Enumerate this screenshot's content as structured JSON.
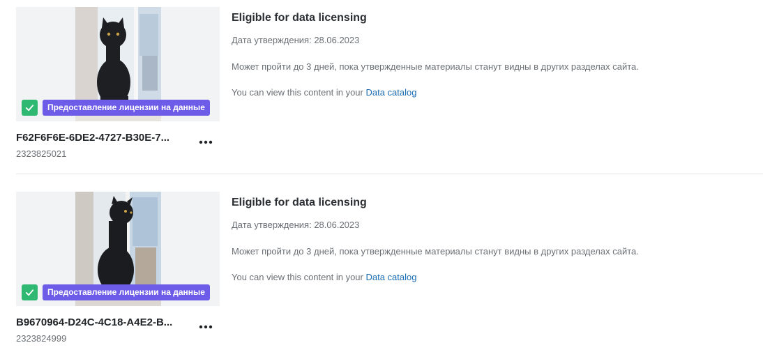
{
  "items": [
    {
      "badge_label": "Предоставление лицензии на данные",
      "filename": "F62F6F6E-6DE2-4727-B30E-7...",
      "file_id": "2323825021",
      "status_title": "Eligible for data licensing",
      "approval_label": "Дата утверждения:",
      "approval_date": "28.06.2023",
      "note": "Может пройти до 3 дней, пока утвержденные материалы станут видны в других разделах сайта.",
      "catalog_prefix": "You can view this content in your",
      "catalog_link": "Data catalog",
      "icons": [
        "check-icon",
        "more-options-icon"
      ]
    },
    {
      "badge_label": "Предоставление лицензии на данные",
      "filename": "B9670964-D24C-4C18-A4E2-B...",
      "file_id": "2323824999",
      "status_title": "Eligible for data licensing",
      "approval_label": "Дата утверждения:",
      "approval_date": "28.06.2023",
      "note": "Может пройти до 3 дней, пока утвержденные материалы станут видны в других разделах сайта.",
      "catalog_prefix": "You can view this content in your",
      "catalog_link": "Data catalog",
      "icons": [
        "check-icon",
        "more-options-icon"
      ]
    }
  ],
  "colors": {
    "badge_bg": "#6c5ce7",
    "check_bg": "#2eb872",
    "link": "#1a6db3",
    "thumb_bg": "#f2f3f5"
  }
}
